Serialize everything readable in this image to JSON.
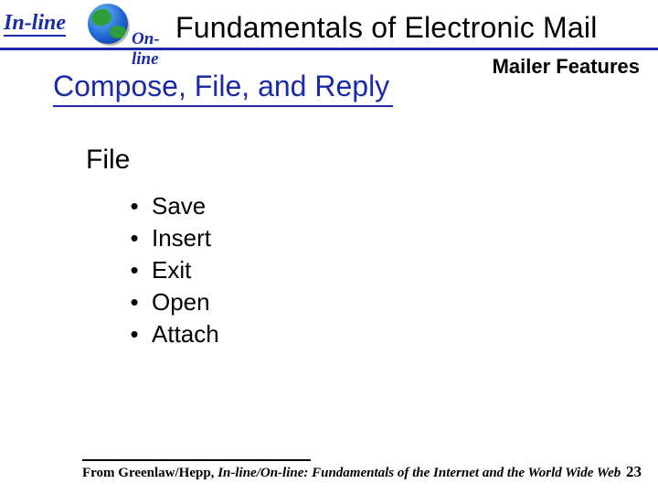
{
  "header": {
    "logo_inline": "In-line",
    "logo_online": "On-line",
    "title": "Fundamentals of Electronic Mail"
  },
  "topic": "Mailer Features",
  "subtitle": "Compose, File, and Reply",
  "section": "File",
  "bullets": [
    "Save",
    "Insert",
    "Exit",
    "Open",
    "Attach"
  ],
  "footer": {
    "prefix": "From Greenlaw/Hepp, ",
    "source": "In-line/On-line: Fundamentals of the Internet and the World Wide Web"
  },
  "page": "23"
}
